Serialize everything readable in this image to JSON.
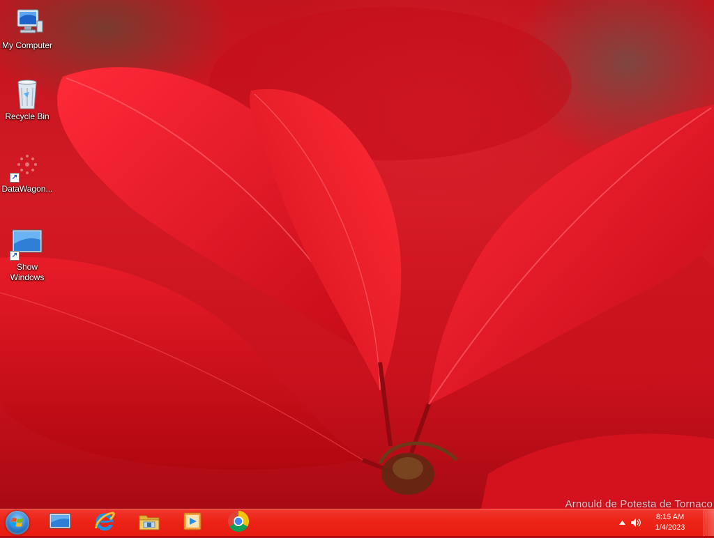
{
  "desktop": {
    "icons": [
      {
        "label": "My Computer",
        "icon": "computer-icon",
        "shortcut": false
      },
      {
        "label": "Recycle Bin",
        "icon": "recycle-bin-icon",
        "shortcut": false
      },
      {
        "label": "DataWagon...",
        "icon": "datawagon-icon",
        "shortcut": true
      },
      {
        "label": "Show Windows",
        "icon": "show-windows-icon",
        "shortcut": true
      }
    ],
    "wallpaper_credit": "Arnould de Potesta de Tornaco"
  },
  "taskbar": {
    "start_icon": "windows-start-icon",
    "pinned": [
      {
        "name": "show-desktop-app",
        "icon": "monitor-icon"
      },
      {
        "name": "internet-explorer",
        "icon": "internet-explorer-icon"
      },
      {
        "name": "file-explorer",
        "icon": "folder-icon"
      },
      {
        "name": "media-player",
        "icon": "media-player-icon"
      },
      {
        "name": "chrome",
        "icon": "chrome-icon"
      }
    ],
    "tray": {
      "time": "8:15 AM",
      "date": "1/4/2023",
      "expand_icon": "chevron-up-icon",
      "volume_icon": "volume-icon"
    }
  },
  "colors": {
    "taskbar": "#ec2416",
    "wallpaper_red": "#c8111c"
  }
}
